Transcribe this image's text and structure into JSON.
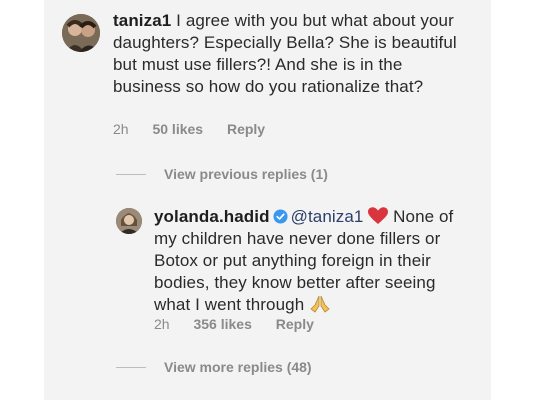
{
  "comment1": {
    "username": "taniza1",
    "text": " I agree with you but what about your daughters?  Especially Bella?  She is beautiful but must use fillers?! And she is in the business so how do you rationalize that?",
    "time": "2h",
    "likes": "50 likes",
    "reply": "Reply"
  },
  "view_previous": "View previous replies (1)",
  "reply1": {
    "username": "yolanda.hadid",
    "mention": "@taniza1",
    "text": " None of my children have never done fillers or Botox or put anything foreign in their bodies, they know better after seeing what I went through ",
    "time": "2h",
    "likes": "356 likes",
    "reply": "Reply",
    "verified_icon": "verified-badge-icon",
    "heart_icon": "red-heart-emoji",
    "hands_icon": "praying-hands-emoji"
  },
  "view_more": "View more replies (48)",
  "colors": {
    "verified": "#3897f0",
    "heart": "#d9353f",
    "meta": "#8a8a8a"
  }
}
